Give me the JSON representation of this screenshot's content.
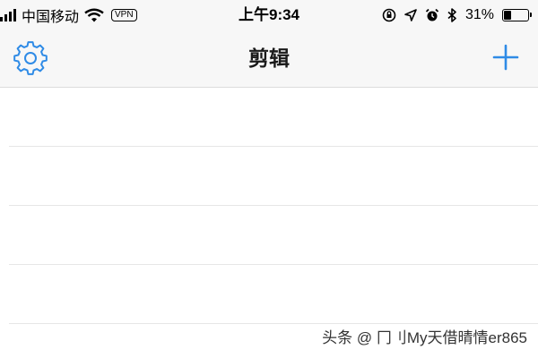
{
  "status_bar": {
    "carrier": "中国移动",
    "vpn": "VPN",
    "time": "上午9:34",
    "battery": "31%",
    "battery_level": 0.31
  },
  "nav": {
    "title": "剪辑",
    "left_icon": "gear-icon",
    "right_icon": "plus-icon"
  },
  "list": {
    "row_count": 4
  },
  "watermark": "头条 @ 冂刂My天借晴情er865",
  "colors": {
    "accent": "#2f8be6",
    "bar_background": "#f7f7f7"
  }
}
